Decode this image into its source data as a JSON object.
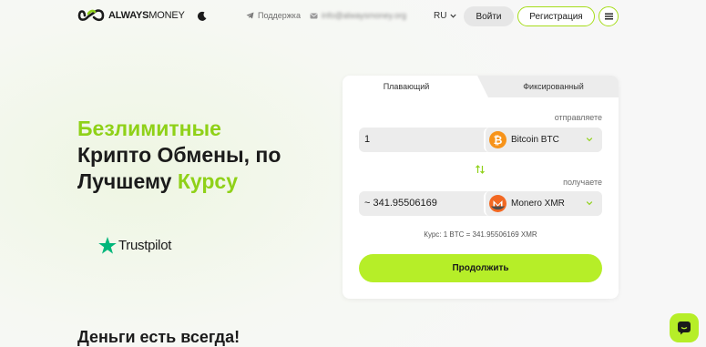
{
  "header": {
    "logo_bold": "ALWAYS",
    "logo_light": "MONEY",
    "support_label": "Поддержка",
    "email": "info@alwaysmoney.org",
    "language": "RU",
    "login_label": "Войти",
    "register_label": "Регистрация"
  },
  "hero": {
    "title_line1": "Безлимитные",
    "title_line2": "Крипто Обмены, по",
    "title_line3_a": "Лучшему ",
    "title_line3_b": "Курсу",
    "trustpilot_label": "Trustpilot",
    "bottom_title": "Деньги есть всегда!"
  },
  "widget": {
    "tab_floating": "Плавающий",
    "tab_fixed": "Фиксированный",
    "send_label": "отправляете",
    "send_amount": "1",
    "send_currency": "Bitcoin BTC",
    "receive_label": "получаете",
    "receive_amount": "~ 341.95506169",
    "receive_currency": "Monero XMR",
    "rate_text": "Курс: 1 BTC = 341.95506169 XMR",
    "continue_label": "Продолжить"
  },
  "colors": {
    "accent": "#b6ee28",
    "accent_text": "#8fd118",
    "bitcoin": "#f7931a",
    "monero": "#f26822"
  }
}
